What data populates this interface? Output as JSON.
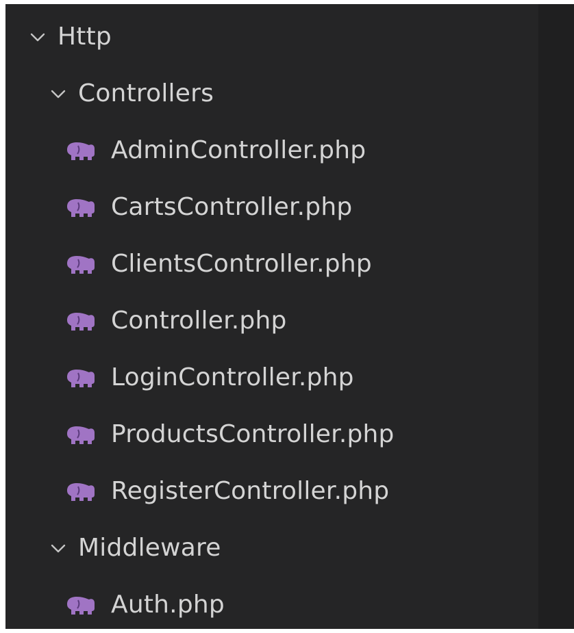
{
  "explorer": {
    "folders": {
      "http": {
        "label": "Http"
      },
      "controllers": {
        "label": "Controllers"
      },
      "middleware": {
        "label": "Middleware"
      }
    },
    "controllers_files": [
      {
        "label": "AdminController.php"
      },
      {
        "label": "CartsController.php"
      },
      {
        "label": "ClientsController.php"
      },
      {
        "label": "Controller.php"
      },
      {
        "label": "LoginController.php"
      },
      {
        "label": "ProductsController.php"
      },
      {
        "label": "RegisterController.php"
      }
    ],
    "middleware_files": [
      {
        "label": "Auth.php"
      }
    ],
    "icons": {
      "chevron": "chevron-down-icon",
      "php": "php-elephant-icon"
    },
    "colors": {
      "background": "#252526",
      "text": "#d4d4d4",
      "php_icon": "#a074c4"
    }
  }
}
